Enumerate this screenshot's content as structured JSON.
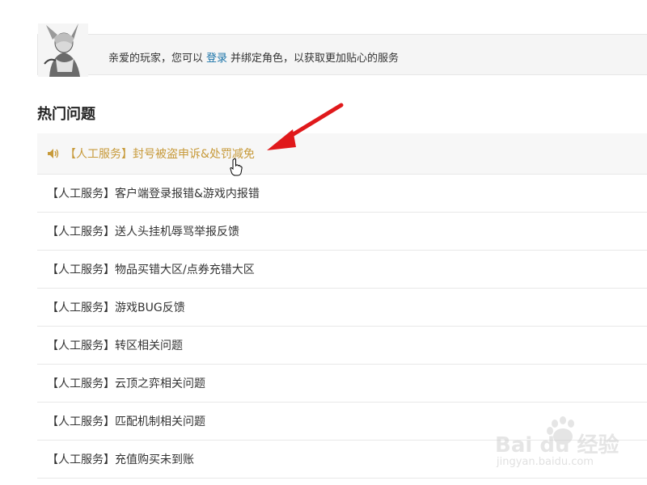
{
  "banner": {
    "text_before": "亲爱的玩家，您可以",
    "login_link": "登录",
    "text_after": "并绑定角色，以获取更加贴心的服务"
  },
  "hot": {
    "title": "热门问题",
    "items": [
      {
        "label": "【人工服务】封号被盗申诉&处罚减免",
        "active": true
      },
      {
        "label": "【人工服务】客户端登录报错&游戏内报错"
      },
      {
        "label": "【人工服务】送人头挂机辱骂举报反馈"
      },
      {
        "label": "【人工服务】物品买错大区/点券充错大区"
      },
      {
        "label": "【人工服务】游戏BUG反馈"
      },
      {
        "label": "【人工服务】转区相关问题"
      },
      {
        "label": "【人工服务】云顶之弈相关问题"
      },
      {
        "label": "【人工服务】匹配机制相关问题"
      },
      {
        "label": "【人工服务】充值购买未到账"
      }
    ]
  },
  "watermark": {
    "logo": "Bai du 经验",
    "url": "jingyan.baidu.com"
  },
  "colors": {
    "link": "#1a73a8",
    "active_text": "#c79a3a",
    "arrow": "#e0191b"
  },
  "icons": [
    "avatar",
    "speaker-icon",
    "hand-cursor-icon",
    "red-arrow"
  ]
}
